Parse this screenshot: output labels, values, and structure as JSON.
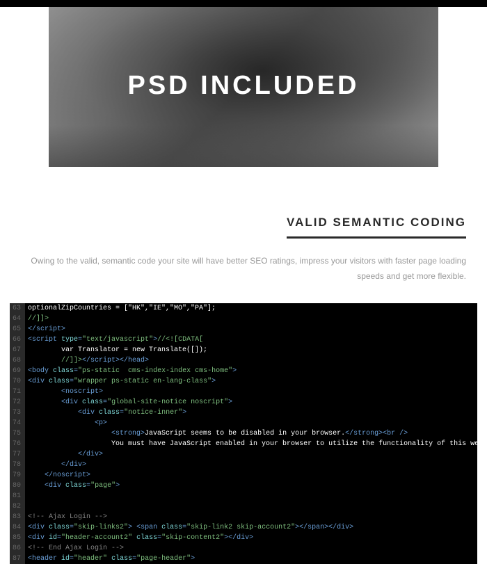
{
  "hero": {
    "title": "PSD INCLUDED"
  },
  "section": {
    "heading": "VALID SEMANTIC CODING",
    "description": "Owing to the valid, semantic code your site will have better SEO ratings, impress your visitors with faster page loading speeds and get more flexible."
  },
  "code": {
    "lines": [
      {
        "num": "63",
        "tokens": [
          {
            "c": "c-white",
            "t": "optionalZipCountries = [\"HK\",\"IE\",\"MO\",\"PA\"];"
          }
        ]
      },
      {
        "num": "64",
        "tokens": [
          {
            "c": "c-green",
            "t": "//]]>"
          }
        ]
      },
      {
        "num": "65",
        "tokens": [
          {
            "c": "c-blue",
            "t": "</script"
          },
          {
            "c": "c-blue",
            "t": ">"
          }
        ]
      },
      {
        "num": "66",
        "tokens": [
          {
            "c": "c-blue",
            "t": "<script "
          },
          {
            "c": "c-cyan",
            "t": "type"
          },
          {
            "c": "c-blue",
            "t": "="
          },
          {
            "c": "c-green",
            "t": "\"text/javascript\""
          },
          {
            "c": "c-blue",
            "t": ">"
          },
          {
            "c": "c-green",
            "t": "//<![CDATA["
          }
        ]
      },
      {
        "num": "67",
        "tokens": [
          {
            "c": "c-white",
            "t": "        var Translator = new Translate([]);"
          }
        ]
      },
      {
        "num": "68",
        "tokens": [
          {
            "c": "c-green",
            "t": "        //]]>"
          },
          {
            "c": "c-blue",
            "t": "</script"
          },
          {
            "c": "c-blue",
            "t": "></head"
          },
          {
            "c": "c-blue",
            "t": ">"
          }
        ]
      },
      {
        "num": "69",
        "tokens": [
          {
            "c": "c-blue",
            "t": "<body "
          },
          {
            "c": "c-cyan",
            "t": "class"
          },
          {
            "c": "c-blue",
            "t": "="
          },
          {
            "c": "c-green",
            "t": "\"ps-static  cms-index-index cms-home\""
          },
          {
            "c": "c-blue",
            "t": ">"
          }
        ]
      },
      {
        "num": "70",
        "tokens": [
          {
            "c": "c-blue",
            "t": "<div "
          },
          {
            "c": "c-cyan",
            "t": "class"
          },
          {
            "c": "c-blue",
            "t": "="
          },
          {
            "c": "c-green",
            "t": "\"wrapper ps-static en-lang-class\""
          },
          {
            "c": "c-blue",
            "t": ">"
          }
        ]
      },
      {
        "num": "71",
        "tokens": [
          {
            "c": "c-white",
            "t": "        "
          },
          {
            "c": "c-blue",
            "t": "<noscript>"
          }
        ]
      },
      {
        "num": "72",
        "tokens": [
          {
            "c": "c-white",
            "t": "        "
          },
          {
            "c": "c-blue",
            "t": "<div "
          },
          {
            "c": "c-cyan",
            "t": "class"
          },
          {
            "c": "c-blue",
            "t": "="
          },
          {
            "c": "c-green",
            "t": "\"global-site-notice noscript\""
          },
          {
            "c": "c-blue",
            "t": ">"
          }
        ]
      },
      {
        "num": "73",
        "tokens": [
          {
            "c": "c-white",
            "t": "            "
          },
          {
            "c": "c-blue",
            "t": "<div "
          },
          {
            "c": "c-cyan",
            "t": "class"
          },
          {
            "c": "c-blue",
            "t": "="
          },
          {
            "c": "c-green",
            "t": "\"notice-inner\""
          },
          {
            "c": "c-blue",
            "t": ">"
          }
        ]
      },
      {
        "num": "74",
        "tokens": [
          {
            "c": "c-white",
            "t": "                "
          },
          {
            "c": "c-blue",
            "t": "<p>"
          }
        ]
      },
      {
        "num": "75",
        "tokens": [
          {
            "c": "c-white",
            "t": "                    "
          },
          {
            "c": "c-blue",
            "t": "<strong>"
          },
          {
            "c": "c-white",
            "t": "JavaScript seems to be disabled in your browser."
          },
          {
            "c": "c-blue",
            "t": "</strong><br "
          },
          {
            "c": "c-blue",
            "t": "/>"
          }
        ]
      },
      {
        "num": "76",
        "tokens": [
          {
            "c": "c-white",
            "t": "                    You must have JavaScript enabled in your browser to utilize the functionality of this website."
          }
        ]
      },
      {
        "num": "77",
        "tokens": [
          {
            "c": "c-white",
            "t": "            "
          },
          {
            "c": "c-blue",
            "t": "</div>"
          }
        ]
      },
      {
        "num": "78",
        "tokens": [
          {
            "c": "c-white",
            "t": "        "
          },
          {
            "c": "c-blue",
            "t": "</div>"
          }
        ]
      },
      {
        "num": "79",
        "tokens": [
          {
            "c": "c-white",
            "t": "    "
          },
          {
            "c": "c-blue",
            "t": "</noscript>"
          }
        ]
      },
      {
        "num": "80",
        "tokens": [
          {
            "c": "c-white",
            "t": "    "
          },
          {
            "c": "c-blue",
            "t": "<div "
          },
          {
            "c": "c-cyan",
            "t": "class"
          },
          {
            "c": "c-blue",
            "t": "="
          },
          {
            "c": "c-green",
            "t": "\"page\""
          },
          {
            "c": "c-blue",
            "t": ">"
          }
        ]
      },
      {
        "num": "81",
        "tokens": []
      },
      {
        "num": "82",
        "tokens": [
          {
            "c": "c-gray",
            "t": "    "
          }
        ]
      },
      {
        "num": "83",
        "tokens": [
          {
            "c": "c-gray",
            "t": "<!-- Ajax Login -->"
          }
        ]
      },
      {
        "num": "84",
        "tokens": [
          {
            "c": "c-blue",
            "t": "<div "
          },
          {
            "c": "c-cyan",
            "t": "class"
          },
          {
            "c": "c-blue",
            "t": "="
          },
          {
            "c": "c-green",
            "t": "\"skip-links2\""
          },
          {
            "c": "c-blue",
            "t": "> <span "
          },
          {
            "c": "c-cyan",
            "t": "class"
          },
          {
            "c": "c-blue",
            "t": "="
          },
          {
            "c": "c-green",
            "t": "\"skip-link2 skip-account2\""
          },
          {
            "c": "c-blue",
            "t": "></span></div>"
          }
        ]
      },
      {
        "num": "85",
        "tokens": [
          {
            "c": "c-blue",
            "t": "<div "
          },
          {
            "c": "c-cyan",
            "t": "id"
          },
          {
            "c": "c-blue",
            "t": "="
          },
          {
            "c": "c-green",
            "t": "\"header-account2\""
          },
          {
            "c": "c-blue",
            "t": " "
          },
          {
            "c": "c-cyan",
            "t": "class"
          },
          {
            "c": "c-blue",
            "t": "="
          },
          {
            "c": "c-green",
            "t": "\"skip-content2\""
          },
          {
            "c": "c-blue",
            "t": "></div>"
          }
        ]
      },
      {
        "num": "86",
        "tokens": [
          {
            "c": "c-gray",
            "t": "<!-- End Ajax Login -->"
          }
        ]
      },
      {
        "num": "87",
        "tokens": [
          {
            "c": "c-blue",
            "t": "<header "
          },
          {
            "c": "c-cyan",
            "t": "id"
          },
          {
            "c": "c-blue",
            "t": "="
          },
          {
            "c": "c-green",
            "t": "\"header\""
          },
          {
            "c": "c-blue",
            "t": " "
          },
          {
            "c": "c-cyan",
            "t": "class"
          },
          {
            "c": "c-blue",
            "t": "="
          },
          {
            "c": "c-green",
            "t": "\"page-header\""
          },
          {
            "c": "c-blue",
            "t": ">"
          }
        ]
      }
    ]
  }
}
